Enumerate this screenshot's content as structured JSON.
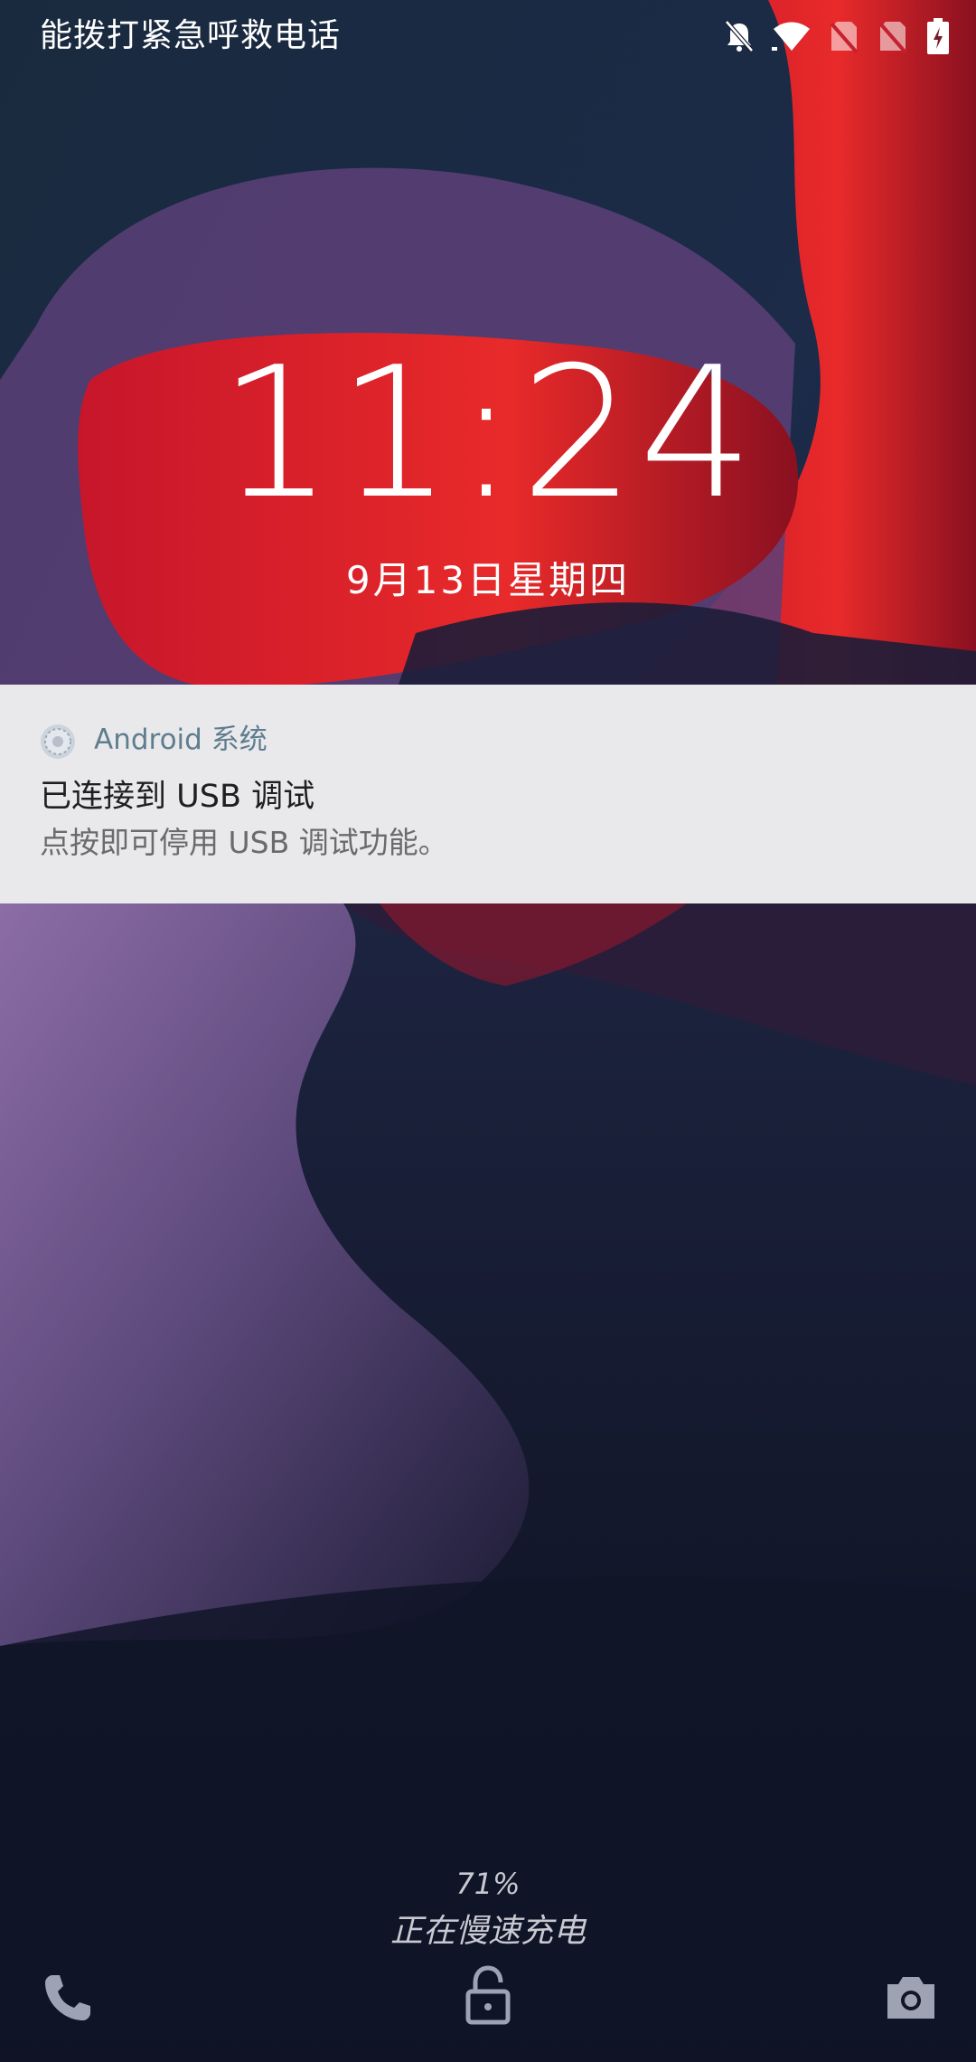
{
  "status_bar": {
    "carrier_text": "能拨打紧急呼救电话",
    "icons": [
      "notifications-off-icon",
      "wifi-icon",
      "no-sim-icon",
      "no-sim-icon",
      "battery-charging-icon"
    ]
  },
  "lockscreen": {
    "time": "11:24",
    "date": "9月13日星期四"
  },
  "notification": {
    "app_name": "Android 系统",
    "title": "已连接到 USB 调试",
    "text": "点按即可停用 USB 调试功能。",
    "app_icon": "android-system-icon"
  },
  "charging": {
    "battery_percent": "71%",
    "status": "正在慢速充电"
  },
  "bottom_actions": {
    "left": "phone-icon",
    "center": "lock-icon",
    "right": "camera-icon"
  },
  "colors": {
    "notification_bg": "#e9e9ec",
    "app_name": "#5f7d8e",
    "accent_red": "#d11a2a"
  }
}
